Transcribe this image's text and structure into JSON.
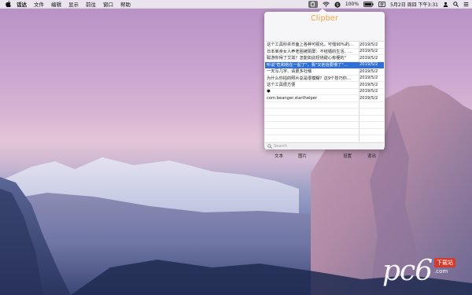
{
  "menubar": {
    "app_name": "话达",
    "menus": [
      "文件",
      "编辑",
      "显示",
      "前往",
      "窗口",
      "帮助"
    ],
    "battery": "100%",
    "datetime": "5月2日 周四 下午3:31",
    "status_icons": [
      "clipper-tray-icon",
      "wifi-icon",
      "s-app-icon",
      "battery-icon",
      "keyboard-icon",
      "user-icon",
      "search-icon",
      "menu-list-icon"
    ]
  },
  "clipper": {
    "title": "Clipber",
    "items": [
      {
        "text": "这个工具秒杀市面上各种可视化。可惜90%的…",
        "date": "2019/5/2"
      },
      {
        "text": "日本单身女人养老困被厕屏：不结婚的生活、…",
        "date": "2019/5/2"
      },
      {
        "text": "聪游你得了艾滋？怎能如此轻佻甜心有梗的\"",
        "date": "2019/5/2"
      },
      {
        "text": "听说\"危和她在一起了\"，我\"又他信要慢了\"…",
        "date": "2019/5/2",
        "selected": true
      },
      {
        "text": "一天写几字、请更多社稽",
        "date": "2019/5/2"
      },
      {
        "text": "为什么你拍的照片总是很模糊？这9个技巧你…",
        "date": "2019/5/2"
      },
      {
        "text": "这个工具很方便",
        "date": "2019/5/2"
      },
      {
        "text": "●",
        "date": "2019/5/2"
      },
      {
        "text": "com.beanger.starthelper",
        "date": "2019/5/2"
      }
    ],
    "empty_rows": 7,
    "search_placeholder": "Search",
    "toolbar": {
      "text": "文本",
      "image": "图片",
      "settings": "设置",
      "quit": "退出"
    }
  },
  "watermark": {
    "logo": "pc6",
    "tag": "下载站",
    "domain": ".com"
  },
  "colors": {
    "accent_title": "#f2a33a",
    "selection": "#2f6fd8"
  }
}
